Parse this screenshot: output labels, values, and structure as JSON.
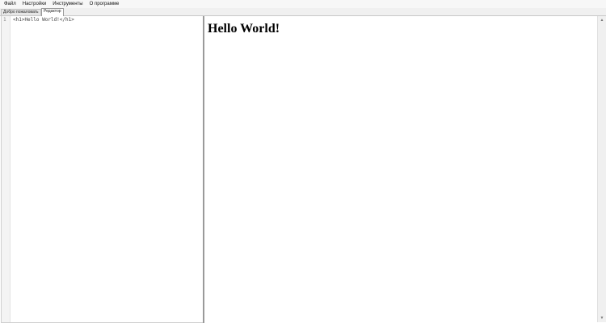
{
  "menubar": {
    "items": [
      {
        "label": "Файл"
      },
      {
        "label": "Настройки"
      },
      {
        "label": "Инструменты"
      },
      {
        "label": "О программе"
      }
    ]
  },
  "tabs": [
    {
      "label": "Добро пожаловать",
      "active": false
    },
    {
      "label": "Редактор",
      "active": true
    }
  ],
  "editor": {
    "line_number": "1",
    "code": "<h1>Hello World!</h1>"
  },
  "preview": {
    "heading": "Hello World!"
  },
  "icons": {
    "scroll_up": "chevron-up-icon",
    "scroll_down": "chevron-down-icon"
  }
}
